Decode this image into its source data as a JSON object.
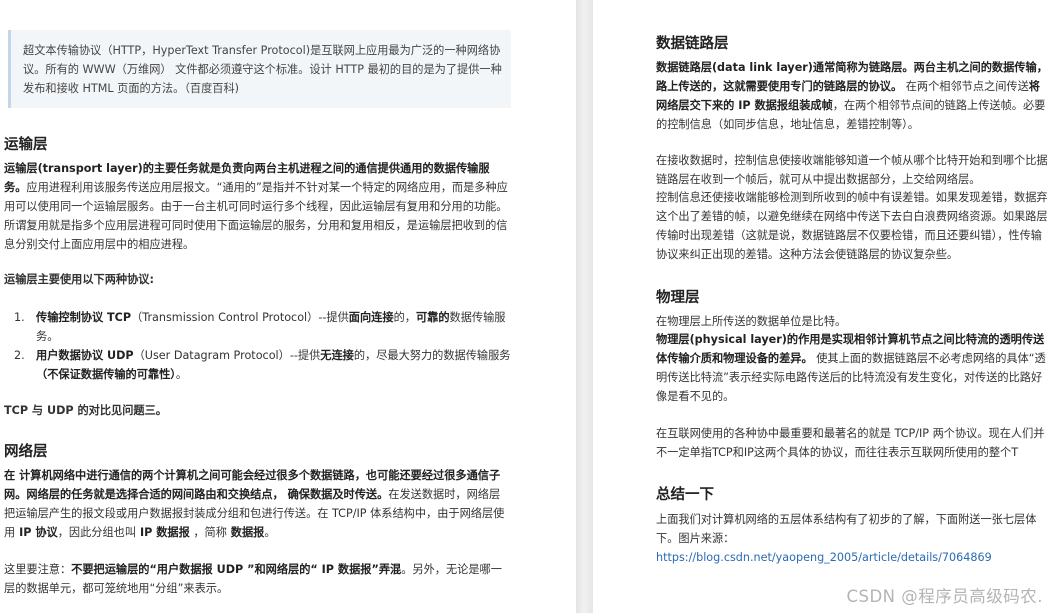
{
  "left": {
    "quote": "超文本传输协议（HTTP，HyperText Transfer Protocol)是互联网上应用最为广泛的一种网络协议。所有的 WWW（万维网） 文件都必须遵守这个标准。设计 HTTP 最初的目的是为了提供一种发布和接收 HTML 页面的方法。（百度百科)",
    "transport": {
      "heading": "运输层",
      "p1_bold": "运输层(transport layer)的主要任务就是负责向两台主机进程之间的通信提供通用的数据传输服务。",
      "p1_rest": "应用进程利用该服务传送应用层报文。“通用的”是指并不针对某一个特定的网络应用，而是多种应用可以使用同一个运输层服务。由于一台主机可同时运行多个线程，因此运输层有复用和分用的功能。所谓复用就是指多个应用层进程可同时使用下面运输层的服务，分用和复用相反，是运输层把收到的信息分别交付上面应用层中的相应进程。",
      "p2": "运输层主要使用以下两种协议:",
      "item1_num": "1.",
      "item1_bold": "传输控制协议 TCP",
      "item1_mid": "（Transmission Control Protocol）--提供",
      "item1_bold2": "面向连接",
      "item1_mid2": "的，",
      "item1_bold3": "可靠的",
      "item1_rest": "数据传输服务。",
      "item2_num": "2.",
      "item2_bold": "用户数据协议 UDP",
      "item2_mid": "（User Datagram Protocol）--提供",
      "item2_bold2": "无连接",
      "item2_mid2": "的，尽最大努力的数据传输服务",
      "item2_bold3": "（不保证数据传输的可靠性）",
      "item2_rest": "。",
      "compare": "TCP 与 UDP 的对比见问题三。"
    },
    "network": {
      "heading": "网络层",
      "p1_bold": "在 计算机网络中进行通信的两个计算机之间可能会经过很多个数据链路，也可能还要经过很多通信子网。网络层的任务就是选择合适的网间路由和交换结点， 确保数据及时传送。",
      "p1_rest": "在发送数据时，网络层把运输层产生的报文段或用户数据报封装成分组和包进行传送。在 TCP/IP 体系结构中，由于网络层使用",
      "p1_bold2": " IP 协议",
      "p1_rest2": "，因此分组也叫",
      "p1_bold3": " IP 数据报",
      "p1_rest3": " ，简称",
      "p1_bold4": " 数据报",
      "p1_rest4": "。",
      "p2_a": "这里要注意：",
      "p2_bold": "不要把运输层的“用户数据报 UDP ”和网络层的“ IP 数据报”弄混",
      "p2_rest": "。另外，无论是哪一层的数据单元，都可笼统地用“分组”来表示。"
    }
  },
  "right": {
    "datalink": {
      "heading": "数据链路层",
      "p1_bold": "数据链路层(data link layer)通常简称为链路层。两台主机之间的数据传输，路上传送的，这就需要使用专门的链路层的协议。",
      "p1_rest": " 在两个相邻节点之间传送",
      "p1_bold2": "将网络层交下来的 IP 数据报组装成帧",
      "p1_rest2": "，在两个相邻节点间的链路上传送帧。必要的控制信息（如同步信息，地址信息，差错控制等）。",
      "p2": "在接收数据时，控制信息使接收端能够知道一个帧从哪个比特开始和到哪个比据链路层在收到一个帧后，就可从中提出数据部分，上交给网络层。",
      "p3": "控制信息还使接收端能够检测到所收到的帧中有误差错。如果发现差错，数据弃这个出了差错的帧，以避免继续在网络中传送下去白白浪费网络资源。如果路层传输时出现差错（这就是说，数据链路层不仅要检错，而且还要纠错），性传输协议来纠正出现的差错。这种方法会使链路层的协议复杂些。"
    },
    "physical": {
      "heading": "物理层",
      "p1": "在物理层上所传送的数据单位是比特。",
      "p2_bold": "物理层(physical layer)的作用是实现相邻计算机节点之间比特流的透明传送体传输介质和物理设备的差异。",
      "p2_rest": " 使其上面的数据链路层不必考虑网络的具体“透明传送比特流”表示经实际电路传送后的比特流没有发生变化，对传送的比路好像是看不见的。",
      "p3": "在互联网使用的各种协中最重要和最著名的就是 TCP/IP 两个协议。现在人们并不一定单指TCP和IP这两个具体的协议，而往往表示互联网所使用的整个T"
    },
    "summary": {
      "heading": "总结一下",
      "p1": "上面我们对计算机网络的五层体系结构有了初步的了解，下面附送一张七层体下。图片来源：",
      "link": "https://blog.csdn.net/yaopeng_2005/article/details/7064869"
    }
  },
  "watermark": "CSDN @程序员高级码农."
}
